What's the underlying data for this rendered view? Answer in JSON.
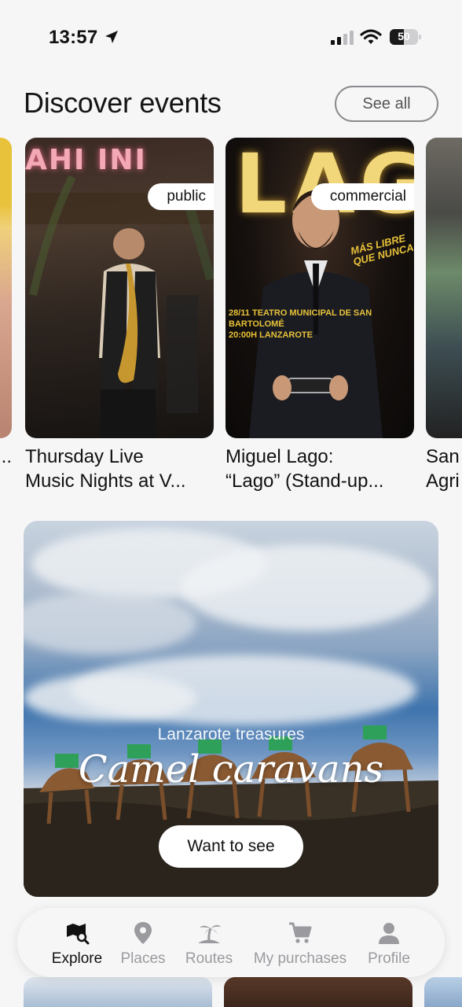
{
  "status_bar": {
    "time": "13:57",
    "battery": "50",
    "battery_level": 0.5,
    "icons": [
      "location-arrow-icon",
      "signal-icon",
      "wifi-icon",
      "battery-icon"
    ]
  },
  "events_section": {
    "title": "Discover events",
    "see_all_label": "See all",
    "cards": [
      {
        "title_line1": "",
        "title_line2": "..."
      },
      {
        "tag": "public",
        "title_line1": "Thursday Live",
        "title_line2": "Music Nights at V...",
        "poster_text": "AHI INI"
      },
      {
        "tag": "commercial",
        "title_line1": "Miguel Lago:",
        "title_line2": "“Lago” (Stand-up...",
        "poster_title": "LAGO",
        "poster_tagline": "MÁS LIBRE QUE NUNCA",
        "poster_info_line1": "28/11 TEATRO MUNICIPAL DE SAN BARTOLOMÉ",
        "poster_info_line2": "20:00H LANZAROTE"
      },
      {
        "title_line1": "San",
        "title_line2": "Agri"
      }
    ]
  },
  "promo": {
    "eyebrow": "Lanzarote treasures",
    "title": "Camel caravans",
    "button_label": "Want to see"
  },
  "tab_bar": {
    "tabs": [
      {
        "label": "Explore",
        "icon": "map-search-icon",
        "active": true
      },
      {
        "label": "Places",
        "icon": "location-pin-icon",
        "active": false
      },
      {
        "label": "Routes",
        "icon": "palm-island-icon",
        "active": false
      },
      {
        "label": "My purchases",
        "icon": "shopping-cart-icon",
        "active": false
      },
      {
        "label": "Profile",
        "icon": "person-icon",
        "active": false
      }
    ],
    "active_color": "#111111",
    "inactive_color": "#9b9b9f"
  }
}
